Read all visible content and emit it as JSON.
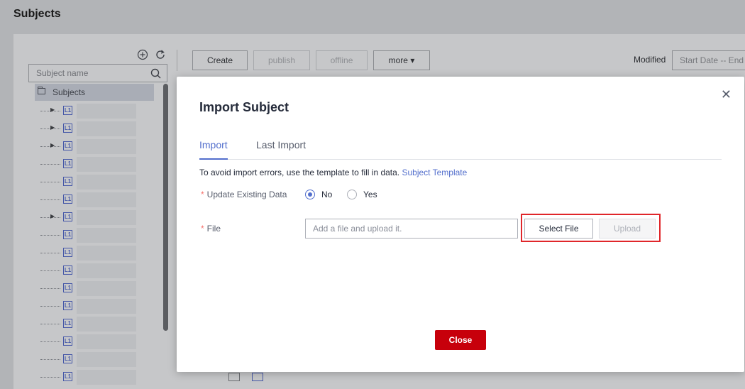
{
  "page": {
    "title": "Subjects"
  },
  "sidebar": {
    "search_placeholder": "Subject name",
    "root_label": "Subjects",
    "node_badge": "L1",
    "tree_nodes": [
      {
        "expandable": true
      },
      {
        "expandable": true
      },
      {
        "expandable": true
      },
      {
        "expandable": false
      },
      {
        "expandable": false
      },
      {
        "expandable": false
      },
      {
        "expandable": true
      },
      {
        "expandable": false
      },
      {
        "expandable": false
      },
      {
        "expandable": false
      },
      {
        "expandable": false
      },
      {
        "expandable": false
      },
      {
        "expandable": false
      },
      {
        "expandable": false
      },
      {
        "expandable": false
      },
      {
        "expandable": false
      }
    ]
  },
  "toolbar": {
    "create_label": "Create",
    "publish_label": "publish",
    "offline_label": "offline",
    "more_label": "more ▾",
    "modified_label": "Modified",
    "date_range_placeholder": "Start Date -- End"
  },
  "modal": {
    "title": "Import Subject",
    "tabs": [
      {
        "label": "Import",
        "active": true
      },
      {
        "label": "Last Import",
        "active": false
      }
    ],
    "hint_text": "To avoid import errors, use the template to fill in data.",
    "template_link": "Subject Template",
    "update_label": "Update Existing Data",
    "radio_options": [
      {
        "label": "No",
        "checked": true
      },
      {
        "label": "Yes",
        "checked": false
      }
    ],
    "file_label": "File",
    "file_placeholder": "Add a file and upload it.",
    "select_file_label": "Select File",
    "upload_label": "Upload",
    "close_label": "Close"
  },
  "colors": {
    "accent": "#526ecc",
    "danger": "#c7000b",
    "highlight": "#e0262a",
    "required": "#f66f6a"
  }
}
